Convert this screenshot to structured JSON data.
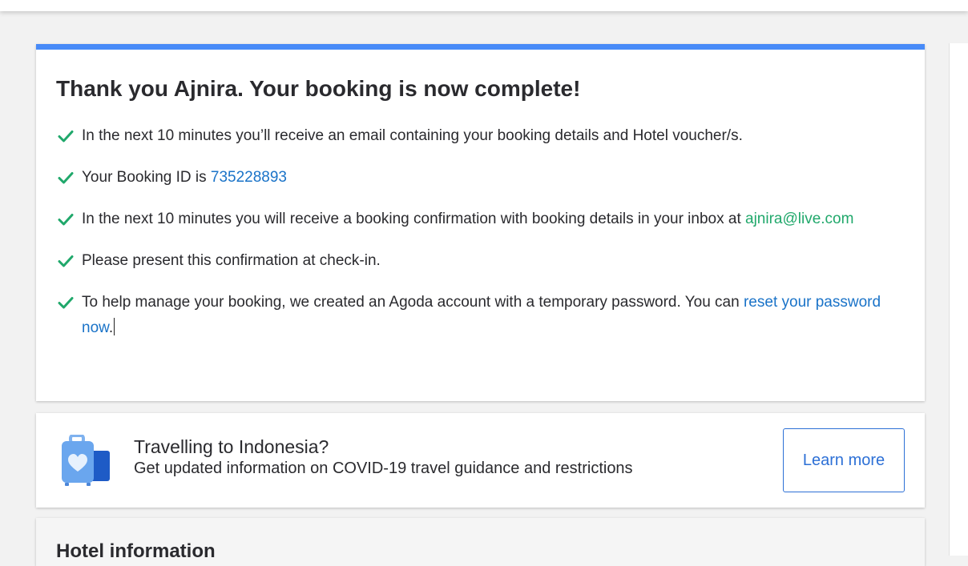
{
  "confirmation": {
    "title": "Thank you Ajnira. Your booking is now complete!",
    "items": [
      {
        "text": "In the next 10 minutes you’ll receive an email containing your booking details and Hotel voucher/s."
      },
      {
        "text": "Your Booking ID is ",
        "booking_id": "735228893"
      },
      {
        "text": "In the next 10 minutes you will receive a booking confirmation with booking details in your inbox at ",
        "email": "ajnira@live.com"
      },
      {
        "text": "Please present this confirmation at check-in."
      },
      {
        "text": "To help manage your booking, we created an Agoda account with a temporary password. You can ",
        "link": "reset your password now",
        "suffix": "."
      }
    ]
  },
  "travel_banner": {
    "title": "Travelling to Indonesia?",
    "subtitle": "Get updated information on COVID-19 travel guidance and restrictions",
    "button_label": "Learn more",
    "icon": "luggage-heart-icon"
  },
  "hotel_info": {
    "title": "Hotel information"
  },
  "colors": {
    "accent_bar": "#488bf8",
    "check": "#20a86b",
    "link": "#1a73c8",
    "email_link": "#20a86b",
    "button_border": "#2d70d6"
  }
}
